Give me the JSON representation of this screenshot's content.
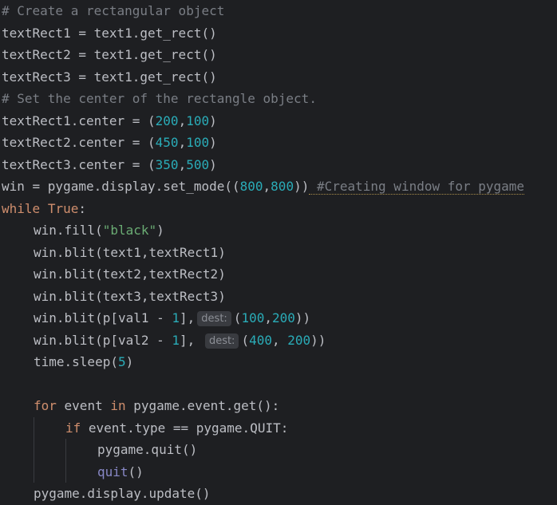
{
  "lines": {
    "l1": {
      "text": "# Create a rectangular object"
    },
    "l2": {
      "a": "textRect1 = text1.get_rect()"
    },
    "l3": {
      "a": "textRect2 = text1.get_rect()"
    },
    "l4": {
      "a": "textRect3 = text1.get_rect()"
    },
    "l5": {
      "text": "# Set the center of the rectangle object."
    },
    "l6": {
      "a": "textRect1.center = (",
      "n1": "200",
      "c": ",",
      "n2": "100",
      "b": ")"
    },
    "l7": {
      "a": "textRect2.center = (",
      "n1": "450",
      "c": ",",
      "n2": "100",
      "b": ")"
    },
    "l8": {
      "a": "textRect3.center = (",
      "n1": "350",
      "c": ",",
      "n2": "500",
      "b": ")"
    },
    "l9": {
      "a": "win = pygame.display.set_mode((",
      "n1": "800",
      "c": ",",
      "n2": "800",
      "b": "))",
      "comment": " #Creating window for pygame"
    },
    "l10": {
      "kw1": "while",
      "sp": " ",
      "kw2": "True",
      "b": ":"
    },
    "l11": {
      "a": "win.fill(",
      "s": "\"black\"",
      "b": ")"
    },
    "l12": {
      "a": "win.blit(text1,textRect1)"
    },
    "l13": {
      "a": "win.blit(text2,textRect2)"
    },
    "l14": {
      "a": "win.blit(text3,textRect3)"
    },
    "l15": {
      "a": "win.blit(p[val1 - ",
      "n0": "1",
      "m": "],",
      "hint": "dest:",
      "p": "(",
      "n1": "100",
      "c": ",",
      "n2": "200",
      "b": "))"
    },
    "l16": {
      "a": "win.blit(p[val2 - ",
      "n0": "1",
      "m": "], ",
      "hint": "dest:",
      "p": "(",
      "n1": "400",
      "c": ", ",
      "n2": "200",
      "b": "))"
    },
    "l17": {
      "a": "time.sleep(",
      "n1": "5",
      "b": ")"
    },
    "l19": {
      "kw1": "for",
      "a": " event ",
      "kw2": "in",
      "b": " pygame.event.get():"
    },
    "l20": {
      "kw1": "if",
      "a": " event.type == pygame.QUIT:"
    },
    "l21": {
      "a": "pygame.quit()"
    },
    "l22": {
      "bi": "quit",
      "b": "()"
    },
    "l23": {
      "a": "pygame.display.update()"
    }
  },
  "colors": {
    "background": "#1e1f22",
    "text": "#bcbec4",
    "comment": "#7a7e85",
    "keyword": "#cf8e6d",
    "number": "#2aacb8",
    "string": "#6aab73",
    "builtin": "#8888c6"
  }
}
